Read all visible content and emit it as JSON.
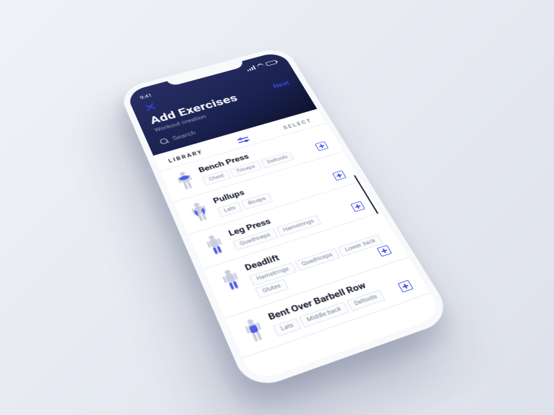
{
  "status": {
    "time": "9:41"
  },
  "header": {
    "title": "Add Exercises",
    "subtitle": "Workout creation",
    "next": "Next",
    "search_placeholder": "Search"
  },
  "tabs": {
    "library": "LIBRARY",
    "select": "SELECT"
  },
  "exercises": [
    {
      "name": "Bench Press",
      "muscles": [
        "Chest",
        "Triceps",
        "Deltoids"
      ]
    },
    {
      "name": "Pullups",
      "muscles": [
        "Lats",
        "Biceps"
      ]
    },
    {
      "name": "Leg Press",
      "muscles": [
        "Quadriceps",
        "Hamstrings"
      ]
    },
    {
      "name": "Deadlift",
      "muscles": [
        "Hamstrings",
        "Quadriceps",
        "Lower back",
        "Glutes"
      ]
    },
    {
      "name": "Bent Over Barbell Row",
      "muscles": [
        "Lats",
        "Middle back",
        "Deltoids"
      ]
    }
  ],
  "colors": {
    "accent": "#3a49e0",
    "navy": "#1b2352"
  }
}
